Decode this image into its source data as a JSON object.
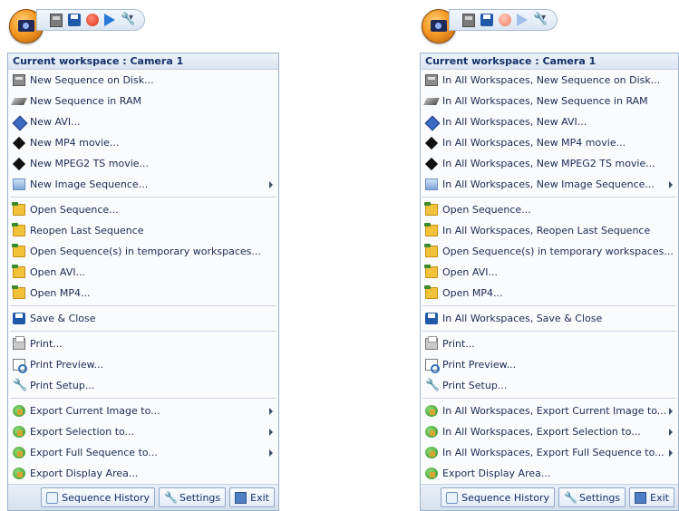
{
  "left": {
    "header": "Current workspace : Camera 1",
    "groups": [
      [
        {
          "label": "New Sequence on Disk...",
          "icon": "disk-icon",
          "submenu": false
        },
        {
          "label": "New Sequence in RAM",
          "icon": "ram-icon",
          "submenu": false
        },
        {
          "label": "New AVI...",
          "icon": "avi-icon",
          "submenu": false
        },
        {
          "label": "New MP4 movie...",
          "icon": "mp4-icon",
          "submenu": false
        },
        {
          "label": "New MPEG2 TS movie...",
          "icon": "mpeg2-icon",
          "submenu": false
        },
        {
          "label": "New Image Sequence...",
          "icon": "image-sequence-icon",
          "submenu": true
        }
      ],
      [
        {
          "label": "Open Sequence...",
          "icon": "open-folder-icon",
          "submenu": false
        },
        {
          "label": "Reopen Last Sequence",
          "icon": "reopen-folder-icon",
          "submenu": false
        },
        {
          "label": "Open Sequence(s) in temporary workspaces...",
          "icon": "folder-icon",
          "submenu": false
        },
        {
          "label": "Open AVI...",
          "icon": "open-folder-icon",
          "submenu": false
        },
        {
          "label": "Open MP4...",
          "icon": "open-folder-icon",
          "submenu": false
        }
      ],
      [
        {
          "label": "Save & Close",
          "icon": "save-icon",
          "submenu": false
        }
      ],
      [
        {
          "label": "Print...",
          "icon": "print-icon",
          "submenu": false
        },
        {
          "label": "Print Preview...",
          "icon": "print-preview-icon",
          "submenu": false
        },
        {
          "label": "Print Setup...",
          "icon": "print-setup-icon",
          "submenu": false
        }
      ],
      [
        {
          "label": "Export Current Image to...",
          "icon": "export-icon",
          "submenu": true
        },
        {
          "label": "Export Selection to...",
          "icon": "export-icon",
          "submenu": true
        },
        {
          "label": "Export Full Sequence to...",
          "icon": "export-icon",
          "submenu": true
        },
        {
          "label": "Export Display Area...",
          "icon": "export-icon",
          "submenu": false
        }
      ]
    ],
    "buttons": [
      "Sequence History",
      "Settings",
      "Exit"
    ]
  },
  "right": {
    "header": "Current workspace : Camera 1",
    "groups": [
      [
        {
          "label": "In All Workspaces, New Sequence on Disk...",
          "icon": "disk-icon",
          "submenu": false
        },
        {
          "label": "In All Workspaces, New Sequence in RAM",
          "icon": "ram-icon",
          "submenu": false
        },
        {
          "label": "In All Workspaces, New AVI...",
          "icon": "avi-icon",
          "submenu": false
        },
        {
          "label": "In All Workspaces, New MP4 movie...",
          "icon": "mp4-icon",
          "submenu": false
        },
        {
          "label": "In All Workspaces, New MPEG2 TS movie...",
          "icon": "mpeg2-icon",
          "submenu": false
        },
        {
          "label": "In All Workspaces, New Image Sequence...",
          "icon": "image-sequence-icon",
          "submenu": true
        }
      ],
      [
        {
          "label": "Open Sequence...",
          "icon": "open-folder-icon",
          "submenu": false
        },
        {
          "label": "In All Workspaces, Reopen Last Sequence",
          "icon": "reopen-folder-icon",
          "submenu": false
        },
        {
          "label": "Open Sequence(s) in temporary workspaces...",
          "icon": "folder-icon",
          "submenu": false
        },
        {
          "label": "Open AVI...",
          "icon": "open-folder-icon",
          "submenu": false
        },
        {
          "label": "Open MP4...",
          "icon": "open-folder-icon",
          "submenu": false
        }
      ],
      [
        {
          "label": "In All Workspaces, Save & Close",
          "icon": "save-icon",
          "submenu": false
        }
      ],
      [
        {
          "label": "Print...",
          "icon": "print-icon",
          "submenu": false
        },
        {
          "label": "Print Preview...",
          "icon": "print-preview-icon",
          "submenu": false
        },
        {
          "label": "Print Setup...",
          "icon": "print-setup-icon",
          "submenu": false
        }
      ],
      [
        {
          "label": "In All Workspaces, Export Current Image to...",
          "icon": "export-icon",
          "submenu": true
        },
        {
          "label": "In All Workspaces, Export Selection to...",
          "icon": "export-icon",
          "submenu": true
        },
        {
          "label": "In All Workspaces, Export Full Sequence to...",
          "icon": "export-icon",
          "submenu": true
        },
        {
          "label": "Export Display Area...",
          "icon": "export-icon",
          "submenu": false
        }
      ]
    ],
    "buttons": [
      "Sequence History",
      "Settings",
      "Exit"
    ]
  }
}
